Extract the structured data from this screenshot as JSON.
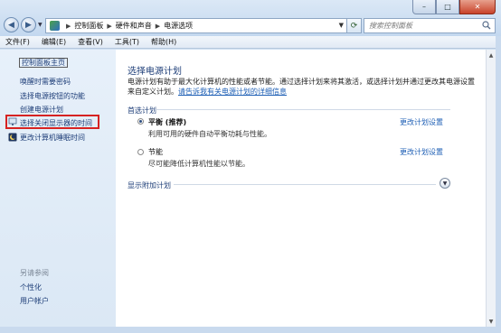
{
  "window": {
    "minimize": "–",
    "maximize": "□",
    "close": "✕"
  },
  "address": {
    "crumbs": [
      "控制面板",
      "硬件和声音",
      "电源选项"
    ]
  },
  "search": {
    "placeholder": "搜索控制面板"
  },
  "menu": [
    "文件(F)",
    "编辑(E)",
    "查看(V)",
    "工具(T)",
    "帮助(H)"
  ],
  "sidebar": {
    "home": "控制面板主页",
    "items": [
      {
        "label": "唤醒时需要密码"
      },
      {
        "label": "选择电源按钮的功能"
      },
      {
        "label": "创建电源计划"
      },
      {
        "label": "选择关闭显示器的时间",
        "icon": "monitor-icon",
        "highlighted": true
      },
      {
        "label": "更改计算机睡眠时间",
        "icon": "moon-icon"
      }
    ],
    "see_also": "另请参阅",
    "bottom_items": [
      {
        "label": "个性化"
      },
      {
        "label": "用户帐户"
      }
    ]
  },
  "main": {
    "title": "选择电源计划",
    "description": "电源计划有助于最大化计算机的性能或者节能。通过选择计划来将其激活，或选择计划并通过更改其电源设置来自定义计划。",
    "description_link": "请告诉我有关电源计划的详细信息",
    "section_label": "首选计划",
    "plans": [
      {
        "name": "平衡 (推荐)",
        "description": "利用可用的硬件自动平衡功耗与性能。",
        "selected": true,
        "change": "更改计划设置"
      },
      {
        "name": "节能",
        "description": "尽可能降低计算机性能以节能。",
        "selected": false,
        "change": "更改计划设置"
      }
    ],
    "more_plans": "显示附加计划"
  },
  "colors": {
    "link": "#1e3e78",
    "highlight_box": "#d62222"
  }
}
